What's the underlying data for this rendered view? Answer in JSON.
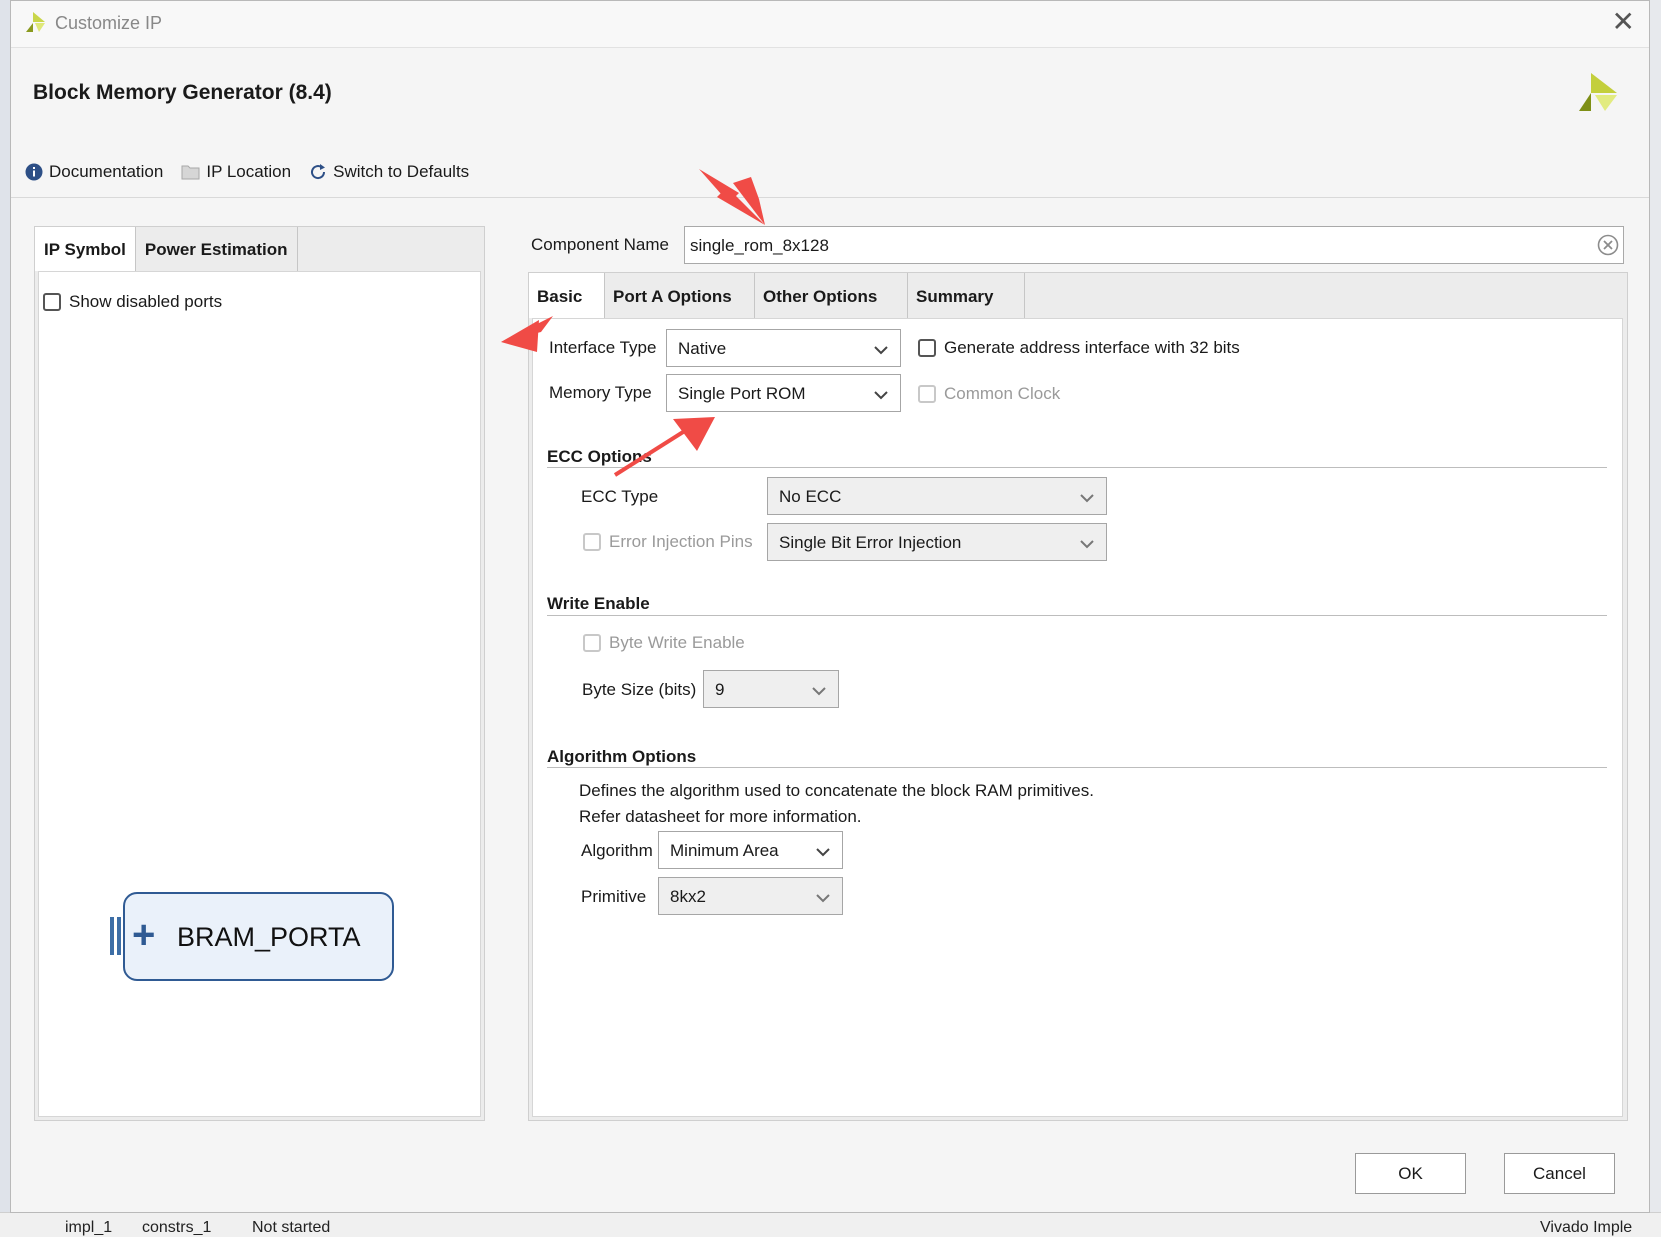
{
  "window": {
    "title": "Customize IP"
  },
  "header": {
    "title": "Block Memory Generator (8.4)"
  },
  "toolbar": {
    "documentation": "Documentation",
    "ip_location": "IP Location",
    "switch_defaults": "Switch to Defaults"
  },
  "left_panel": {
    "tabs": [
      "IP Symbol",
      "Power Estimation"
    ],
    "active_tab": "IP Symbol",
    "show_disabled_ports": {
      "label": "Show disabled ports",
      "checked": false
    },
    "symbol": {
      "port_label": "BRAM_PORTA"
    }
  },
  "component": {
    "label": "Component Name",
    "value": "single_rom_8x128"
  },
  "right_panel": {
    "tabs": [
      "Basic",
      "Port A Options",
      "Other Options",
      "Summary"
    ],
    "active_tab": "Basic",
    "interface_type": {
      "label": "Interface Type",
      "value": "Native"
    },
    "memory_type": {
      "label": "Memory Type",
      "value": "Single Port ROM"
    },
    "gen_address": {
      "label": "Generate address interface with 32 bits",
      "checked": false
    },
    "common_clock": {
      "label": "Common Clock",
      "checked": false,
      "disabled": true
    },
    "ecc": {
      "title": "ECC Options",
      "type_label": "ECC Type",
      "type_value": "No ECC",
      "error_pins_label": "Error Injection Pins",
      "error_pins_value": "Single Bit Error Injection"
    },
    "write_enable": {
      "title": "Write Enable",
      "byte_write_label": "Byte Write Enable",
      "byte_size_label": "Byte Size (bits)",
      "byte_size_value": "9"
    },
    "algorithm": {
      "title": "Algorithm Options",
      "desc_line1": "Defines the algorithm used to concatenate the block RAM primitives.",
      "desc_line2": "Refer datasheet for more information.",
      "algorithm_label": "Algorithm",
      "algorithm_value": "Minimum Area",
      "primitive_label": "Primitive",
      "primitive_value": "8kx2"
    }
  },
  "buttons": {
    "ok": "OK",
    "cancel": "Cancel"
  },
  "background_status": {
    "col1": "impl_1",
    "col2": "constrs_1",
    "col3": "Not started",
    "col4": "Vivado Imple"
  },
  "colors": {
    "accent": "#2f5a93",
    "annotation_arrow": "#f04b46",
    "logo_green": "#b5c435"
  },
  "icons": [
    "info-icon",
    "folder-icon",
    "refresh-icon",
    "close-icon",
    "clear-icon",
    "chevron-down-icon",
    "xilinx-logo"
  ]
}
